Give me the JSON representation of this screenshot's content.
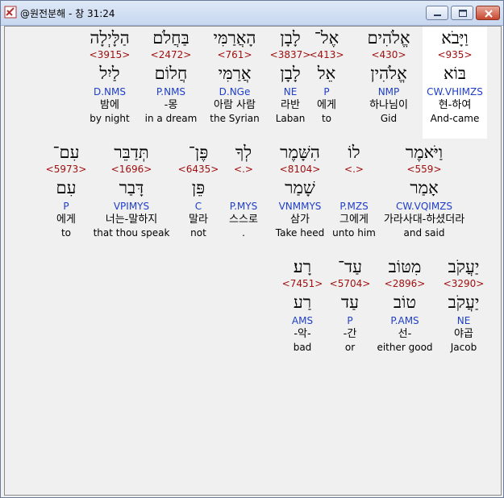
{
  "window": {
    "title": "@원전분해 - 창 31:24",
    "icon": "bible-app-icon",
    "controls": {
      "minimize": "minimize-icon",
      "maximize": "maximize-icon",
      "close": "close-icon"
    }
  },
  "colors": {
    "strong_number": "#a01010",
    "morphology": "#1f3ec8",
    "selected_background": "#ffffff"
  },
  "rows": [
    {
      "words": [
        {
          "hebrew": "וַיָּבֹא",
          "strong": "<935>",
          "lexeme": "בּוֹא",
          "morph": "CW.VHIMZS",
          "korean": "현-하여",
          "english": "And-came",
          "selected": true
        },
        {
          "hebrew": "אֱלֹהִים",
          "strong": "<430>",
          "lexeme": "אֱלֹהִין",
          "morph": "NMP",
          "korean": "하나님이",
          "english": "Gid",
          "selected": false
        },
        {
          "hebrew": "אֶל־",
          "strong": "<413>",
          "lexeme": "אֵל",
          "morph": "P",
          "korean": "에게",
          "english": "to",
          "selected": false
        },
        {
          "hebrew": "לָבָן",
          "strong": "<3837>",
          "lexeme": "לָבָן",
          "morph": "NE",
          "korean": "라반",
          "english": "Laban",
          "selected": false
        },
        {
          "hebrew": "הָאֲרַמִּי",
          "strong": "<761>",
          "lexeme": "אֲרַמִּי",
          "morph": "D.NGe",
          "korean": "아람 사람",
          "english": "the Syrian",
          "selected": false
        },
        {
          "hebrew": "בַּחֲלֹם",
          "strong": "<2472>",
          "lexeme": "חֲלוֹם",
          "morph": "P.NMS",
          "korean": "-몽",
          "english": "in a dream",
          "selected": false
        },
        {
          "hebrew": "הַלָּיְלָה",
          "strong": "<3915>",
          "lexeme": "לַיִל",
          "morph": "D.NMS",
          "korean": "밤에",
          "english": "by night",
          "selected": false
        }
      ]
    },
    {
      "words": [
        {
          "hebrew": "וַיֹּאמֶר",
          "strong": "<559>",
          "lexeme": "אָמַר",
          "morph": "CW.VQIMZS",
          "korean": "가라사대-하셨더라",
          "english": "and said",
          "selected": false
        },
        {
          "hebrew": "לוֹ",
          "strong": "<.>",
          "lexeme": "",
          "morph": "P.MZS",
          "korean": "그에게",
          "english": "unto him",
          "selected": false
        },
        {
          "hebrew": "הִשָּׁמֶר",
          "strong": "<8104>",
          "lexeme": "שָׁמַר",
          "morph": "VNMMYS",
          "korean": "삼가",
          "english": "Take heed",
          "selected": false
        },
        {
          "hebrew": "לְךָ",
          "strong": "<.>",
          "lexeme": "",
          "morph": "P.MYS",
          "korean": "스스로",
          "english": ".",
          "selected": false
        },
        {
          "hebrew": "פֶּן־",
          "strong": "<6435>",
          "lexeme": "פֵּן",
          "morph": "C",
          "korean": "말라",
          "english": "not",
          "selected": false
        },
        {
          "hebrew": "תְּדַבֵּר",
          "strong": "<1696>",
          "lexeme": "דָּבַר",
          "morph": "VPIMYS",
          "korean": "너는-말하지",
          "english": "that thou speak",
          "selected": false
        },
        {
          "hebrew": "עִם־",
          "strong": "<5973>",
          "lexeme": "עִם",
          "morph": "P",
          "korean": "에게",
          "english": "to",
          "selected": false
        }
      ]
    },
    {
      "words": [
        {
          "hebrew": "יַעֲקֹב",
          "strong": "<3290>",
          "lexeme": "יַעֲקֹב",
          "morph": "NE",
          "korean": "야곱",
          "english": "Jacob",
          "selected": false
        },
        {
          "hebrew": "מִטּוֹב",
          "strong": "<2896>",
          "lexeme": "טוֹב",
          "morph": "P.AMS",
          "korean": "선-",
          "english": "either good",
          "selected": false
        },
        {
          "hebrew": "עַד־",
          "strong": "<5704>",
          "lexeme": "עַד",
          "morph": "P",
          "korean": "-간",
          "english": "or",
          "selected": false
        },
        {
          "hebrew": "רָע׃",
          "strong": "<7451>",
          "lexeme": "רַע",
          "morph": "AMS",
          "korean": "-악-",
          "english": "bad",
          "selected": false
        }
      ]
    }
  ]
}
